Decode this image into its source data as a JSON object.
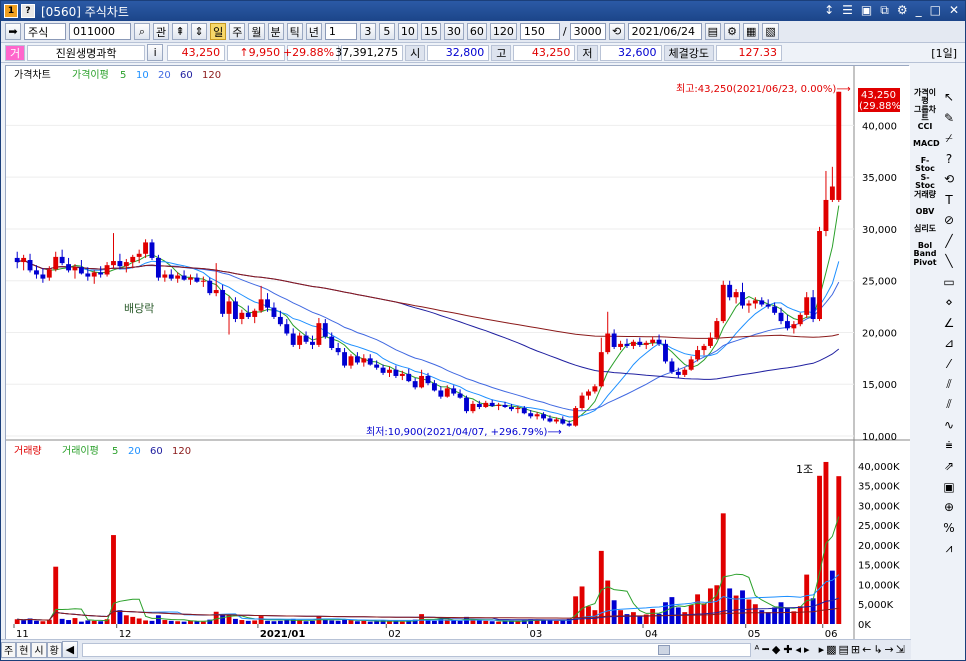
{
  "window": {
    "title": "[0560] 주식차트",
    "icon1": "1",
    "icon2": "?",
    "controls": [
      "↕",
      "☰",
      "▣",
      "⧉",
      "⚙",
      "_",
      "□",
      "✕"
    ]
  },
  "toolbar": {
    "market": "주식",
    "code": "011000",
    "buttons": [
      "관"
    ],
    "periods": [
      "일",
      "주",
      "월",
      "분",
      "틱",
      "년"
    ],
    "active_period": "일",
    "interval": "1",
    "intervals": [
      "3",
      "5",
      "10",
      "15",
      "30",
      "60",
      "120"
    ],
    "count": "150",
    "total": "3000",
    "date": "2021/06/24"
  },
  "quote": {
    "badge": "거",
    "name": "진원생명과학",
    "info_btn": "i",
    "price": "43,250",
    "change": "↑9,950",
    "rate": "+29.88%",
    "volume": "37,391,275",
    "open_label": "시",
    "open": "32,800",
    "high_label": "고",
    "high": "43,250",
    "low_label": "저",
    "low": "32,600",
    "strength_label": "체결강도",
    "strength": "127.33",
    "period_tag": "[1일]"
  },
  "price_panel": {
    "legend": [
      "가격차트",
      "가격이평",
      "5",
      "10",
      "20",
      "60",
      "120"
    ],
    "y_ticks": [
      "40,000",
      "35,000",
      "30,000",
      "25,000",
      "20,000",
      "15,000",
      "10,000"
    ],
    "last_price": "43,250",
    "last_rate": "(29.88%)",
    "high_annot": "최고:43,250(2021/06/23, 0.00%)⟶",
    "low_annot": "최저:10,900(2021/04/07, +296.79%)⟶",
    "event_label": "배당락"
  },
  "volume_panel": {
    "legend": [
      "거래량",
      "거래이평",
      "5",
      "20",
      "60",
      "120"
    ],
    "y_ticks": [
      "40,000K",
      "35,000K",
      "30,000K",
      "25,000K",
      "20,000K",
      "15,000K",
      "10,000K",
      "5,000K",
      "0K"
    ],
    "marker": "1조"
  },
  "x_axis": [
    "11",
    "12",
    "2021/01",
    "02",
    "03",
    "04",
    "05",
    "06"
  ],
  "bottom_tabs": [
    "주",
    "현",
    "시",
    "황"
  ],
  "right_indicators": [
    "가격이평",
    "그룹차트",
    "CCI",
    "MACD",
    "F-Stoc",
    "S-Stoc",
    "거래량",
    "OBV",
    "심리도",
    "Bol Band",
    "Pivot"
  ],
  "colors": {
    "up": "#e00000",
    "down": "#0000d0",
    "ma5": "#2aa02a",
    "ma10": "#1e90ff",
    "ma20": "#4169e1",
    "ma60": "#2020a0",
    "ma120": "#8b1a1a"
  },
  "chart_data": {
    "type": "candlestick",
    "price_range": [
      10000,
      44000
    ],
    "volume_range": [
      0,
      42000000
    ],
    "candles": [
      [
        27200,
        27800,
        26200,
        26800
      ],
      [
        26800,
        27500,
        26000,
        27200
      ],
      [
        27000,
        27600,
        25800,
        26000
      ],
      [
        26000,
        26500,
        25200,
        25600
      ],
      [
        25600,
        26200,
        24800,
        25200
      ],
      [
        25300,
        26400,
        25000,
        26100
      ],
      [
        26100,
        27800,
        25900,
        27300
      ],
      [
        27300,
        28000,
        26500,
        26700
      ],
      [
        26600,
        27200,
        25800,
        26000
      ],
      [
        26000,
        26600,
        25200,
        26300
      ],
      [
        26300,
        27000,
        25600,
        25700
      ],
      [
        25700,
        26300,
        25000,
        25400
      ],
      [
        25400,
        26000,
        24700,
        25800
      ],
      [
        25800,
        26400,
        25300,
        25600
      ],
      [
        25600,
        26800,
        25400,
        26500
      ],
      [
        26500,
        29600,
        26200,
        26900
      ],
      [
        26900,
        27600,
        26100,
        26400
      ],
      [
        26400,
        27100,
        25800,
        26800
      ],
      [
        26800,
        27500,
        26200,
        27300
      ],
      [
        27300,
        28000,
        26700,
        27600
      ],
      [
        27600,
        29000,
        27200,
        28700
      ],
      [
        28700,
        29000,
        27000,
        27200
      ],
      [
        27200,
        27500,
        25000,
        25300
      ],
      [
        25300,
        26000,
        24900,
        25600
      ],
      [
        25600,
        26100,
        25000,
        25200
      ],
      [
        25200,
        25800,
        24800,
        25500
      ],
      [
        25500,
        26000,
        25000,
        25100
      ],
      [
        25100,
        25600,
        24600,
        25300
      ],
      [
        25300,
        25700,
        24800,
        24900
      ],
      [
        24900,
        25400,
        24400,
        25000
      ],
      [
        25000,
        25300,
        23600,
        23800
      ],
      [
        23800,
        26700,
        23500,
        24100
      ],
      [
        24100,
        24600,
        21500,
        21800
      ],
      [
        21800,
        23500,
        19800,
        23000
      ],
      [
        23000,
        23400,
        21000,
        21300
      ],
      [
        21300,
        22200,
        20800,
        21900
      ],
      [
        21900,
        22600,
        21300,
        21500
      ],
      [
        21500,
        22300,
        20900,
        22100
      ],
      [
        22100,
        24500,
        21900,
        23200
      ],
      [
        23200,
        23800,
        22000,
        22400
      ],
      [
        22400,
        22900,
        21300,
        21500
      ],
      [
        21500,
        22100,
        20600,
        20800
      ],
      [
        20800,
        21300,
        19700,
        19900
      ],
      [
        19900,
        20400,
        18600,
        18800
      ],
      [
        18800,
        20000,
        18400,
        19700
      ],
      [
        19700,
        20100,
        18900,
        19100
      ],
      [
        19100,
        19700,
        18400,
        18800
      ],
      [
        18800,
        21400,
        18600,
        20900
      ],
      [
        20900,
        21300,
        19400,
        19600
      ],
      [
        19600,
        20000,
        18300,
        18500
      ],
      [
        18500,
        19000,
        17800,
        18100
      ],
      [
        18100,
        18500,
        16600,
        16800
      ],
      [
        16800,
        17900,
        16500,
        17700
      ],
      [
        17700,
        18100,
        16900,
        17100
      ],
      [
        17100,
        17900,
        16700,
        17500
      ],
      [
        17500,
        17900,
        16800,
        16900
      ],
      [
        16900,
        17300,
        16400,
        16600
      ],
      [
        16600,
        16900,
        15900,
        16100
      ],
      [
        16100,
        16700,
        15700,
        16400
      ],
      [
        16400,
        16800,
        15600,
        15800
      ],
      [
        15800,
        16300,
        15400,
        16000
      ],
      [
        16000,
        16500,
        15200,
        15300
      ],
      [
        15300,
        15600,
        14500,
        14700
      ],
      [
        14700,
        16400,
        14600,
        15800
      ],
      [
        15800,
        16100,
        14900,
        15100
      ],
      [
        15100,
        15400,
        14300,
        14400
      ],
      [
        14400,
        14800,
        13600,
        13800
      ],
      [
        13800,
        14900,
        13700,
        14600
      ],
      [
        14600,
        14900,
        13900,
        14100
      ],
      [
        14100,
        14500,
        13600,
        13700
      ],
      [
        13700,
        13900,
        12200,
        12400
      ],
      [
        12400,
        13400,
        12200,
        13100
      ],
      [
        13100,
        13400,
        12600,
        12800
      ],
      [
        12800,
        13400,
        12700,
        13200
      ],
      [
        13200,
        13500,
        12800,
        12900
      ],
      [
        12900,
        13200,
        12500,
        13000
      ],
      [
        13000,
        13300,
        12700,
        12800
      ],
      [
        12800,
        13100,
        12400,
        12600
      ],
      [
        12600,
        12900,
        12200,
        12700
      ],
      [
        12700,
        12900,
        12100,
        12200
      ],
      [
        12200,
        12500,
        11700,
        11900
      ],
      [
        11900,
        12300,
        11600,
        12100
      ],
      [
        12100,
        12300,
        11500,
        11700
      ],
      [
        11700,
        12000,
        11300,
        11400
      ],
      [
        11400,
        11800,
        11200,
        11600
      ],
      [
        11600,
        11900,
        11100,
        11200
      ],
      [
        11200,
        11500,
        10900,
        11000
      ],
      [
        11000,
        12900,
        10900,
        12700
      ],
      [
        12700,
        14200,
        12500,
        13900
      ],
      [
        13900,
        14500,
        13500,
        14300
      ],
      [
        14300,
        15000,
        14100,
        14800
      ],
      [
        14800,
        19500,
        14700,
        18100
      ],
      [
        18100,
        22000,
        17900,
        19900
      ],
      [
        19900,
        20300,
        18400,
        18600
      ],
      [
        18600,
        19200,
        18300,
        18900
      ],
      [
        18900,
        19400,
        18500,
        18700
      ],
      [
        18700,
        19300,
        18400,
        19100
      ],
      [
        19100,
        19500,
        18600,
        18800
      ],
      [
        18800,
        19200,
        18400,
        19000
      ],
      [
        19000,
        19600,
        18700,
        19300
      ],
      [
        19300,
        19800,
        18700,
        18900
      ],
      [
        18900,
        19300,
        17000,
        17200
      ],
      [
        17200,
        17500,
        16000,
        16200
      ],
      [
        16200,
        16600,
        15600,
        15900
      ],
      [
        15900,
        16600,
        15700,
        16400
      ],
      [
        16400,
        17700,
        16300,
        17400
      ],
      [
        17400,
        18700,
        17200,
        18300
      ],
      [
        18300,
        18900,
        17800,
        18700
      ],
      [
        18700,
        20000,
        18500,
        19500
      ],
      [
        19500,
        21400,
        19300,
        21100
      ],
      [
        21100,
        25000,
        20900,
        24600
      ],
      [
        24600,
        25000,
        23100,
        23400
      ],
      [
        23400,
        24200,
        22800,
        23900
      ],
      [
        23900,
        24800,
        22300,
        22600
      ],
      [
        22600,
        23100,
        21900,
        22800
      ],
      [
        22800,
        23400,
        22300,
        23100
      ],
      [
        23100,
        23400,
        22500,
        22700
      ],
      [
        22700,
        23200,
        22300,
        22500
      ],
      [
        22500,
        22900,
        21700,
        21900
      ],
      [
        21900,
        22400,
        20800,
        21100
      ],
      [
        21100,
        21700,
        20200,
        20400
      ],
      [
        20400,
        21100,
        19900,
        20800
      ],
      [
        20800,
        21900,
        20600,
        21700
      ],
      [
        21700,
        23900,
        21400,
        23400
      ],
      [
        23400,
        24100,
        21000,
        21300
      ],
      [
        21300,
        30200,
        21100,
        29800
      ],
      [
        29800,
        35600,
        29300,
        32800
      ],
      [
        32800,
        36000,
        32600,
        34100
      ],
      [
        32800,
        43250,
        32600,
        43250
      ]
    ],
    "volumes": [
      [
        1200000,
        1
      ],
      [
        900000,
        0
      ],
      [
        1400000,
        0
      ],
      [
        800000,
        0
      ],
      [
        700000,
        1
      ],
      [
        1100000,
        1
      ],
      [
        14500000,
        1
      ],
      [
        1300000,
        0
      ],
      [
        1000000,
        0
      ],
      [
        1500000,
        1
      ],
      [
        600000,
        0
      ],
      [
        900000,
        0
      ],
      [
        800000,
        1
      ],
      [
        700000,
        0
      ],
      [
        1200000,
        1
      ],
      [
        22500000,
        1
      ],
      [
        3500000,
        0
      ],
      [
        2200000,
        1
      ],
      [
        1800000,
        1
      ],
      [
        1400000,
        1
      ],
      [
        900000,
        1
      ],
      [
        800000,
        0
      ],
      [
        2200000,
        0
      ],
      [
        1000000,
        1
      ],
      [
        800000,
        0
      ],
      [
        700000,
        1
      ],
      [
        600000,
        0
      ],
      [
        900000,
        1
      ],
      [
        700000,
        0
      ],
      [
        600000,
        1
      ],
      [
        1100000,
        0
      ],
      [
        3100000,
        1
      ],
      [
        2300000,
        0
      ],
      [
        2500000,
        1
      ],
      [
        1300000,
        0
      ],
      [
        1000000,
        1
      ],
      [
        800000,
        0
      ],
      [
        900000,
        1
      ],
      [
        2000000,
        1
      ],
      [
        800000,
        0
      ],
      [
        700000,
        0
      ],
      [
        800000,
        0
      ],
      [
        1000000,
        0
      ],
      [
        1300000,
        0
      ],
      [
        900000,
        1
      ],
      [
        700000,
        0
      ],
      [
        800000,
        0
      ],
      [
        1900000,
        1
      ],
      [
        1100000,
        0
      ],
      [
        900000,
        0
      ],
      [
        800000,
        0
      ],
      [
        1200000,
        0
      ],
      [
        1000000,
        1
      ],
      [
        700000,
        0
      ],
      [
        800000,
        1
      ],
      [
        600000,
        0
      ],
      [
        700000,
        0
      ],
      [
        900000,
        0
      ],
      [
        700000,
        1
      ],
      [
        800000,
        0
      ],
      [
        600000,
        1
      ],
      [
        700000,
        0
      ],
      [
        1100000,
        0
      ],
      [
        2500000,
        1
      ],
      [
        900000,
        0
      ],
      [
        800000,
        0
      ],
      [
        1300000,
        0
      ],
      [
        1100000,
        1
      ],
      [
        900000,
        0
      ],
      [
        800000,
        0
      ],
      [
        1800000,
        0
      ],
      [
        1200000,
        1
      ],
      [
        900000,
        0
      ],
      [
        800000,
        1
      ],
      [
        700000,
        0
      ],
      [
        600000,
        1
      ],
      [
        700000,
        0
      ],
      [
        800000,
        0
      ],
      [
        700000,
        1
      ],
      [
        900000,
        0
      ],
      [
        1200000,
        0
      ],
      [
        900000,
        1
      ],
      [
        1000000,
        0
      ],
      [
        1100000,
        0
      ],
      [
        800000,
        1
      ],
      [
        900000,
        0
      ],
      [
        1300000,
        0
      ],
      [
        7000000,
        1
      ],
      [
        9500000,
        1
      ],
      [
        4500000,
        1
      ],
      [
        3500000,
        1
      ],
      [
        18500000,
        1
      ],
      [
        11000000,
        1
      ],
      [
        6000000,
        0
      ],
      [
        3500000,
        1
      ],
      [
        2500000,
        0
      ],
      [
        3000000,
        1
      ],
      [
        2000000,
        0
      ],
      [
        2400000,
        1
      ],
      [
        3800000,
        1
      ],
      [
        2600000,
        0
      ],
      [
        5500000,
        0
      ],
      [
        6800000,
        0
      ],
      [
        4200000,
        0
      ],
      [
        3000000,
        1
      ],
      [
        4800000,
        1
      ],
      [
        7500000,
        1
      ],
      [
        5200000,
        1
      ],
      [
        9000000,
        1
      ],
      [
        9800000,
        1
      ],
      [
        28000000,
        1
      ],
      [
        9000000,
        0
      ],
      [
        7200000,
        1
      ],
      [
        8500000,
        0
      ],
      [
        6200000,
        1
      ],
      [
        5000000,
        1
      ],
      [
        3500000,
        0
      ],
      [
        3000000,
        0
      ],
      [
        4200000,
        0
      ],
      [
        5500000,
        0
      ],
      [
        4000000,
        0
      ],
      [
        3200000,
        1
      ],
      [
        4500000,
        1
      ],
      [
        12500000,
        1
      ],
      [
        6500000,
        0
      ],
      [
        37500000,
        1
      ],
      [
        41000000,
        1
      ],
      [
        13500000,
        0
      ],
      [
        37400000,
        1
      ]
    ]
  }
}
